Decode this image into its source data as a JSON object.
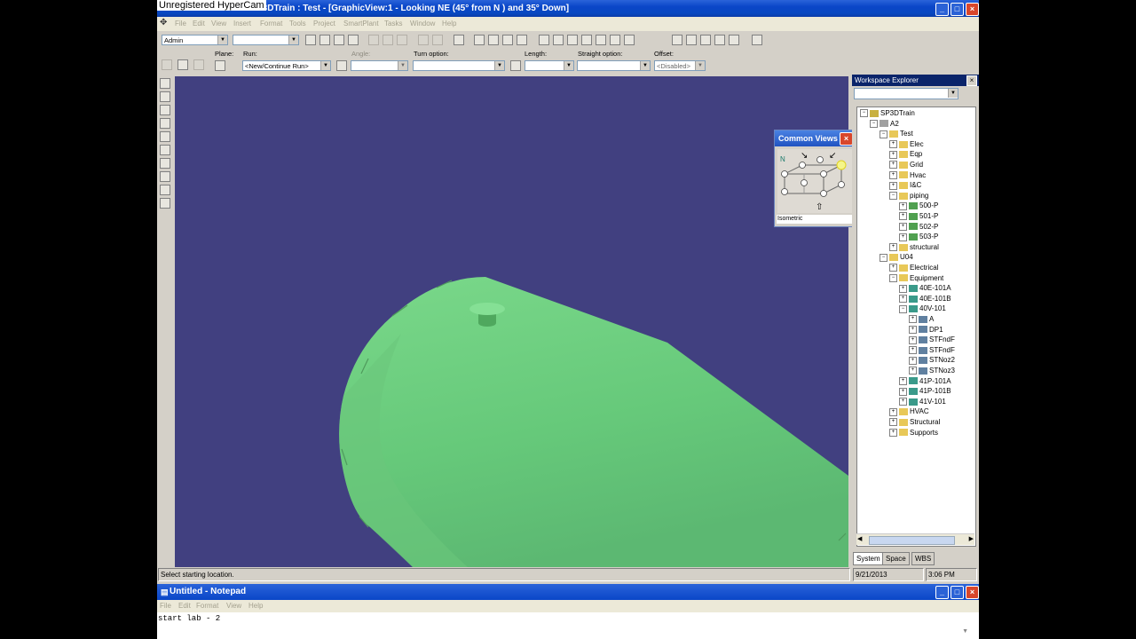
{
  "watermark": "Unregistered HyperCam",
  "app": {
    "title": "P3DTrain : Test - [GraphicView:1 - Looking NE (45° from N ) and 35° Down]",
    "menu": [
      "File",
      "Edit",
      "View",
      "Insert",
      "Format",
      "Tools",
      "Project",
      "SmartPlant",
      "Tasks",
      "Window",
      "Help"
    ]
  },
  "toolbar": {
    "role_value": "Admin",
    "filter_value": ""
  },
  "ribbon": {
    "plane_label": "Plane:",
    "run_label": "Run:",
    "run_value": "<New/Continue Run>",
    "angle_label": "Angle:",
    "turn_label": "Turn option:",
    "length_label": "Length:",
    "straight_label": "Straight option:",
    "offset_label": "Offset:",
    "offset_value": "<Disabled>"
  },
  "common_views": {
    "title": "Common Views",
    "north": "N",
    "selected": "Isometric"
  },
  "status": {
    "message": "Select starting location.",
    "date": "9/21/2013",
    "time": "3:06 PM"
  },
  "workspace": {
    "title": "Workspace Explorer",
    "filter_value": "",
    "tabs": [
      "System",
      "Space",
      "WBS"
    ],
    "tree": [
      {
        "label": "SP3DTrain",
        "depth": 0,
        "icon": "db"
      },
      {
        "label": "A2",
        "depth": 1,
        "icon": "area"
      },
      {
        "label": "Test",
        "depth": 2,
        "icon": "folder"
      },
      {
        "label": "Elec",
        "depth": 3,
        "icon": "folder"
      },
      {
        "label": "Eqp",
        "depth": 3,
        "icon": "folder"
      },
      {
        "label": "Grid",
        "depth": 3,
        "icon": "folder"
      },
      {
        "label": "Hvac",
        "depth": 3,
        "icon": "folder"
      },
      {
        "label": "I&C",
        "depth": 3,
        "icon": "folder"
      },
      {
        "label": "piping",
        "depth": 3,
        "icon": "folder"
      },
      {
        "label": "500-P",
        "depth": 4,
        "icon": "pipe"
      },
      {
        "label": "501-P",
        "depth": 4,
        "icon": "pipe"
      },
      {
        "label": "502-P",
        "depth": 4,
        "icon": "pipe"
      },
      {
        "label": "503-P",
        "depth": 4,
        "icon": "pipe"
      },
      {
        "label": "structural",
        "depth": 3,
        "icon": "folder"
      },
      {
        "label": "U04",
        "depth": 2,
        "icon": "folder"
      },
      {
        "label": "Electrical",
        "depth": 3,
        "icon": "folder"
      },
      {
        "label": "Equipment",
        "depth": 3,
        "icon": "folder"
      },
      {
        "label": "40E-101A",
        "depth": 4,
        "icon": "equip"
      },
      {
        "label": "40E-101B",
        "depth": 4,
        "icon": "equip"
      },
      {
        "label": "40V-101",
        "depth": 4,
        "icon": "equip"
      },
      {
        "label": "A",
        "depth": 5,
        "icon": "nozzle"
      },
      {
        "label": "DP1",
        "depth": 5,
        "icon": "nozzle"
      },
      {
        "label": "STFndF",
        "depth": 5,
        "icon": "nozzle"
      },
      {
        "label": "STFndF",
        "depth": 5,
        "icon": "nozzle"
      },
      {
        "label": "STNoz2",
        "depth": 5,
        "icon": "nozzle"
      },
      {
        "label": "STNoz3",
        "depth": 5,
        "icon": "nozzle"
      },
      {
        "label": "41P-101A",
        "depth": 4,
        "icon": "equip"
      },
      {
        "label": "41P-101B",
        "depth": 4,
        "icon": "equip"
      },
      {
        "label": "41V-101",
        "depth": 4,
        "icon": "equip"
      },
      {
        "label": "HVAC",
        "depth": 3,
        "icon": "folder"
      },
      {
        "label": "Structural",
        "depth": 3,
        "icon": "folder"
      },
      {
        "label": "Supports",
        "depth": 3,
        "icon": "folder"
      }
    ]
  },
  "notepad": {
    "title": "Untitled - Notepad",
    "menu": [
      "File",
      "Edit",
      "Format",
      "View",
      "Help"
    ],
    "text": "start lab - 2"
  },
  "colors": {
    "viewport_bg": "#414080",
    "vessel": "#6fd080",
    "titlebar": "#0a46c8"
  }
}
